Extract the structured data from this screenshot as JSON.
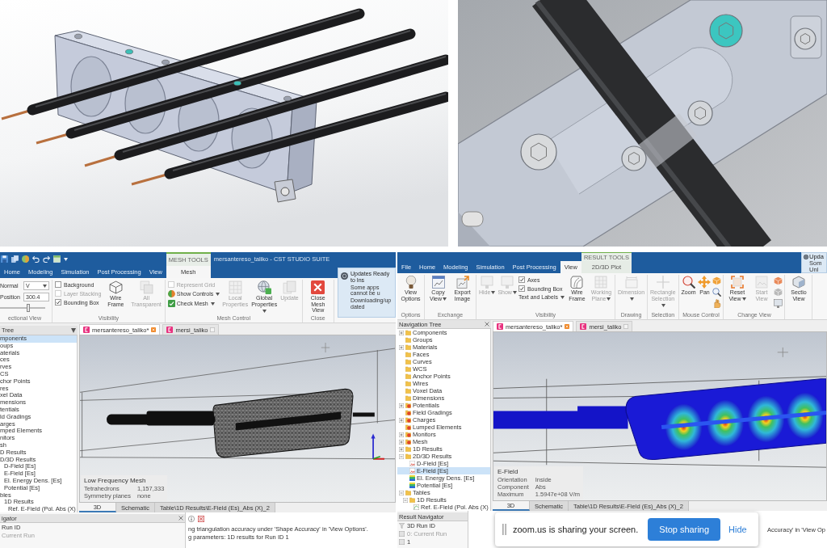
{
  "mesh_window": {
    "title": "mersantereso_taliko - CST STUDIO SUITE",
    "context_label": "MESH TOOLS",
    "tabs": [
      {
        "label": "Home",
        "selected": false,
        "contextual": false
      },
      {
        "label": "Modeling",
        "selected": false,
        "contextual": false
      },
      {
        "label": "Simulation",
        "selected": false,
        "contextual": false
      },
      {
        "label": "Post Processing",
        "selected": false,
        "contextual": false
      },
      {
        "label": "View",
        "selected": false,
        "contextual": false
      },
      {
        "label": "Mesh",
        "selected": true,
        "contextual": true
      }
    ],
    "ribbon": [
      {
        "label": "ectional View",
        "items": [
          {
            "kind": "dropdown",
            "label": "Normal",
            "value": "V"
          },
          {
            "kind": "field",
            "label": "Position",
            "value": "300.4"
          },
          {
            "kind": "slider",
            "level": 0.62
          }
        ]
      },
      {
        "label": "Visibility",
        "items": [
          {
            "kind": "check",
            "label": "Background",
            "checked": false,
            "disabled": false
          },
          {
            "kind": "check",
            "label": "Layer Stacking",
            "checked": false,
            "disabled": true
          },
          {
            "kind": "check",
            "label": "Bounding Box",
            "checked": true,
            "disabled": false
          },
          {
            "kind": "large",
            "label": "Wire Frame",
            "disabled": false,
            "menu": false
          },
          {
            "kind": "large",
            "label": "All Transparent",
            "disabled": true,
            "menu": false
          }
        ]
      },
      {
        "label": "Mesh Control",
        "items": [
          {
            "kind": "check",
            "label": "Represent Grid",
            "checked": false,
            "disabled": true
          },
          {
            "kind": "small",
            "label": "Show Controls",
            "disabled": false,
            "menu": true
          },
          {
            "kind": "small",
            "label": "Check Mesh",
            "disabled": false,
            "menu": true
          },
          {
            "kind": "large",
            "label": "Local Properties",
            "disabled": true,
            "menu": false
          },
          {
            "kind": "large",
            "label": "Global Properties",
            "disabled": false,
            "menu": true
          },
          {
            "kind": "large",
            "label": "Update",
            "disabled": true,
            "menu": false
          }
        ]
      },
      {
        "label": "Close",
        "items": [
          {
            "kind": "large",
            "label": "Close Mesh View",
            "disabled": false,
            "menu": false
          }
        ]
      }
    ],
    "notification": {
      "title": "Updates Ready to Ins",
      "lines": [
        "Some apps cannot be u",
        "Downloading/updated"
      ]
    },
    "tree": {
      "title": "Tree",
      "items": [
        {
          "label": "mponents",
          "selected": true
        },
        {
          "label": "oups",
          "selected": false
        },
        {
          "label": "aterials",
          "selected": false
        },
        {
          "label": "ces",
          "selected": false
        },
        {
          "label": "rves",
          "selected": false
        },
        {
          "label": "CS",
          "selected": false
        },
        {
          "label": "chor Points",
          "selected": false
        },
        {
          "label": "res",
          "selected": false
        },
        {
          "label": "xel Data",
          "selected": false
        },
        {
          "label": "mensions",
          "selected": false
        },
        {
          "label": "tentials",
          "selected": false
        },
        {
          "label": "ld Gradings",
          "selected": false
        },
        {
          "label": "arges",
          "selected": false
        },
        {
          "label": "mped Elements",
          "selected": false
        },
        {
          "label": "nitors",
          "selected": false
        },
        {
          "label": "sh",
          "selected": false
        },
        {
          "label": "D Results",
          "selected": false
        },
        {
          "label": "D/3D Results",
          "selected": false,
          "children": [
            {
              "label": "D-Field [Es]",
              "selected": false
            },
            {
              "label": "E-Field [Es]",
              "selected": false
            },
            {
              "label": "El. Energy Dens. [Es]",
              "selected": false
            },
            {
              "label": "Potential [Es]",
              "selected": false
            }
          ]
        },
        {
          "label": "bles",
          "selected": false,
          "children": [
            {
              "label": "1D Results",
              "selected": false,
              "children": [
                {
                  "label": "Ref. E-Field (Pol. Abs (X)",
                  "selected": false
                }
              ]
            }
          ]
        }
      ]
    },
    "documents": [
      {
        "label": "mersantereso_taliko*",
        "selected": true
      },
      {
        "label": "mersi_taliko",
        "selected": false
      }
    ],
    "view": {
      "kind": "mesh",
      "info": {
        "title": "Low Frequency Mesh",
        "rows": [
          {
            "label": "Tetrahedrons",
            "value": "1,157,333"
          },
          {
            "label": "Symmetry planes",
            "value": "none"
          }
        ]
      }
    },
    "view_tabs": [
      {
        "label": "3D",
        "selected": true
      },
      {
        "label": "Schematic",
        "selected": false
      },
      {
        "label": "Table\\1D Results\\E-Field (Es)_Abs (X)_2",
        "selected": false
      }
    ],
    "navigator": {
      "title": "igator",
      "rows": [
        {
          "label": "Run ID",
          "disabled": false
        },
        {
          "label": "Current Run",
          "disabled": true
        }
      ]
    },
    "messages": [
      "ng triangulation accuracy under 'Shape Accuracy' in 'View Options'.",
      "g parameters: 1D results for Run ID 1"
    ]
  },
  "result_window": {
    "context_label": "RESULT TOOLS",
    "tabs": [
      {
        "label": "File",
        "selected": false,
        "contextual": false
      },
      {
        "label": "Home",
        "selected": false,
        "contextual": false
      },
      {
        "label": "Modeling",
        "selected": false,
        "contextual": false
      },
      {
        "label": "Simulation",
        "selected": false,
        "contextual": false
      },
      {
        "label": "Post Processing",
        "selected": false,
        "contextual": false
      },
      {
        "label": "View",
        "selected": true,
        "contextual": false
      },
      {
        "label": "2D/3D Plot",
        "selected": false,
        "contextual": true
      }
    ],
    "ribbon": [
      {
        "label": "Options",
        "items": [
          {
            "kind": "large",
            "label": "View Options",
            "disabled": false,
            "menu": false
          }
        ]
      },
      {
        "label": "Exchange",
        "items": [
          {
            "kind": "large",
            "label": "Copy View",
            "disabled": false,
            "menu": true
          },
          {
            "kind": "large",
            "label": "Export Image",
            "disabled": false,
            "menu": false
          }
        ]
      },
      {
        "label": "Visibility",
        "items": [
          {
            "kind": "large",
            "label": "Hide",
            "disabled": true,
            "menu": true
          },
          {
            "kind": "large",
            "label": "Show",
            "disabled": true,
            "menu": true
          },
          {
            "kind": "check",
            "label": "Axes",
            "checked": true,
            "disabled": false
          },
          {
            "kind": "check",
            "label": "Bounding Box",
            "checked": true,
            "disabled": false
          },
          {
            "kind": "small",
            "label": "Text and Labels",
            "disabled": false,
            "menu": true
          },
          {
            "kind": "large",
            "label": "Wire Frame",
            "disabled": false,
            "menu": false
          },
          {
            "kind": "large",
            "label": "Working Plane",
            "disabled": true,
            "menu": true
          }
        ]
      },
      {
        "label": "Drawing",
        "items": [
          {
            "kind": "large",
            "label": "Dimension",
            "disabled": true,
            "menu": true
          }
        ]
      },
      {
        "label": "Selection",
        "items": [
          {
            "kind": "large",
            "label": "Rectangle Selection",
            "disabled": true,
            "menu": true
          }
        ]
      },
      {
        "label": "Mouse Control",
        "items": [
          {
            "kind": "large",
            "label": "Zoom",
            "disabled": false,
            "menu": false
          },
          {
            "kind": "large",
            "label": "Pan",
            "disabled": false,
            "menu": false
          },
          {
            "kind": "mini"
          },
          {
            "kind": "mini"
          },
          {
            "kind": "mini"
          }
        ]
      },
      {
        "label": "Change View",
        "items": [
          {
            "kind": "large",
            "label": "Reset View",
            "disabled": false,
            "menu": true
          },
          {
            "kind": "large",
            "label": "Start View",
            "disabled": true,
            "menu": false
          },
          {
            "kind": "mini"
          },
          {
            "kind": "mini"
          },
          {
            "kind": "mini"
          }
        ]
      },
      {
        "items": [
          {
            "kind": "large",
            "label": "Sectio View",
            "disabled": false,
            "menu": false
          }
        ]
      }
    ],
    "notification": {
      "title": "Upda",
      "lines": [
        "Som",
        "Unl"
      ]
    },
    "tree": {
      "title": "Navigation Tree",
      "items": [
        {
          "label": "Components",
          "kind": "folder",
          "expanded": false,
          "selected": false
        },
        {
          "label": "Groups",
          "kind": "folder",
          "selected": false
        },
        {
          "label": "Materials",
          "kind": "folder",
          "expanded": false,
          "selected": false
        },
        {
          "label": "Faces",
          "kind": "folder",
          "selected": false
        },
        {
          "label": "Curves",
          "kind": "folder",
          "selected": false
        },
        {
          "label": "WCS",
          "kind": "folder",
          "selected": false
        },
        {
          "label": "Anchor Points",
          "kind": "folder",
          "selected": false
        },
        {
          "label": "Wires",
          "kind": "folder",
          "selected": false
        },
        {
          "label": "Voxel Data",
          "kind": "folder",
          "selected": false
        },
        {
          "label": "Dimensions",
          "kind": "folder",
          "selected": false
        },
        {
          "label": "Potentials",
          "kind": "source",
          "expanded": false,
          "selected": false
        },
        {
          "label": "Field Gradings",
          "kind": "source",
          "selected": false
        },
        {
          "label": "Charges",
          "kind": "source",
          "expanded": false,
          "selected": false
        },
        {
          "label": "Lumped Elements",
          "kind": "source",
          "selected": false
        },
        {
          "label": "Monitors",
          "kind": "source",
          "expanded": false,
          "selected": false
        },
        {
          "label": "Mesh",
          "kind": "source",
          "expanded": false,
          "selected": false
        },
        {
          "label": "1D Results",
          "kind": "folder",
          "expanded": false,
          "selected": false
        },
        {
          "label": "2D/3D Results",
          "kind": "folder",
          "expanded": true,
          "selected": false,
          "children": [
            {
              "label": "D-Field [Es]",
              "kind": "field",
              "selected": false
            },
            {
              "label": "E-Field [Es]",
              "kind": "field",
              "selected": true
            },
            {
              "label": "El. Energy Dens. [Es]",
              "kind": "plot",
              "selected": false
            },
            {
              "label": "Potential [Es]",
              "kind": "plot",
              "selected": false
            }
          ]
        },
        {
          "label": "Tables",
          "kind": "folder",
          "expanded": true,
          "selected": false,
          "children": [
            {
              "label": "1D Results",
              "kind": "folder",
              "expanded": true,
              "selected": false,
              "children": [
                {
                  "label": "Ref. E-Field (Pol. Abs (X)",
                  "kind": "curve",
                  "selected": false
                }
              ]
            }
          ]
        }
      ]
    },
    "documents": [
      {
        "label": "mersantereso_taliko*",
        "selected": true
      },
      {
        "label": "mersi_taliko",
        "selected": false
      }
    ],
    "view": {
      "kind": "field",
      "info": {
        "title": "E-Field",
        "rows": [
          {
            "label": "Orientation",
            "value": "Inside"
          },
          {
            "label": "Component",
            "value": "Abs"
          },
          {
            "label": "Maximum",
            "value": "1.5947e+08 V/m"
          }
        ]
      }
    },
    "view_tabs": [
      {
        "label": "3D",
        "selected": true
      },
      {
        "label": "Schematic",
        "selected": false
      },
      {
        "label": "Table\\1D Results\\E-Field (Es)_Abs (X)_2",
        "selected": false
      }
    ],
    "navigator": {
      "title": "Result Navigator",
      "rows": [
        {
          "label": "3D Run ID",
          "disabled": false
        },
        {
          "label": "0: Current Run",
          "disabled": true
        },
        {
          "label": "1",
          "disabled": false
        }
      ]
    },
    "messages": [
      "Accuracy' in 'View Op"
    ]
  },
  "share_bar": {
    "message": "zoom.us is sharing your screen.",
    "stop_button": "Stop sharing",
    "hide_link": "Hide"
  }
}
